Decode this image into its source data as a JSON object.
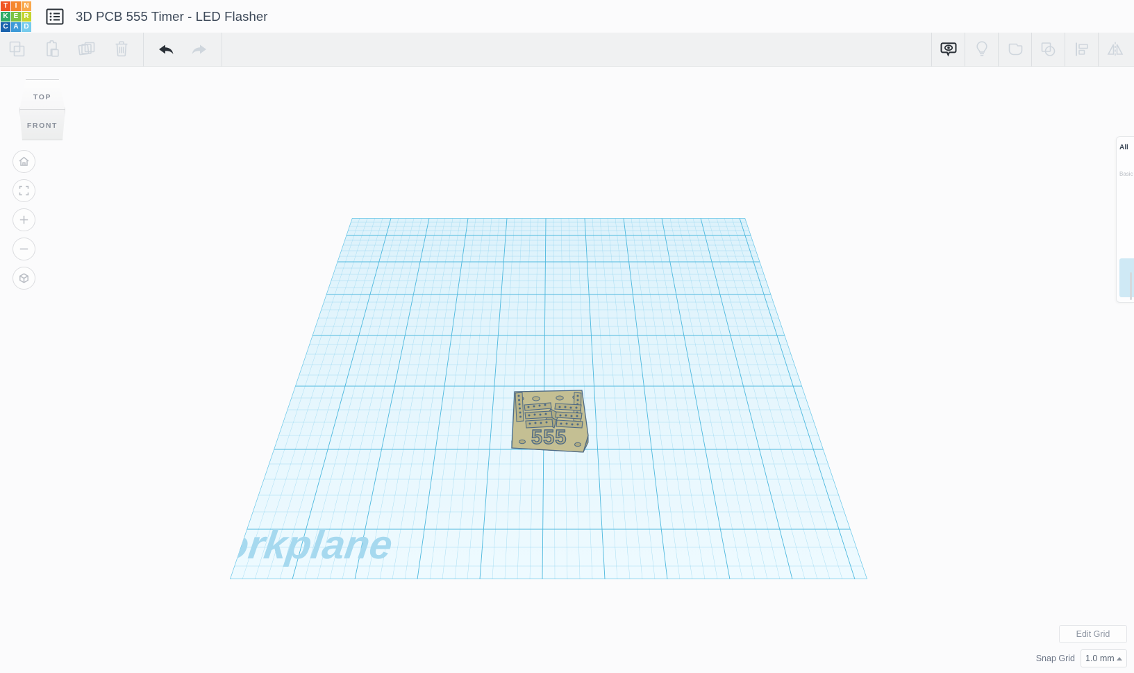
{
  "app": {
    "name": "Tinkercad",
    "logo_letters": [
      {
        "ch": "T",
        "color": "#f05523"
      },
      {
        "ch": "I",
        "color": "#f5872e"
      },
      {
        "ch": "N",
        "color": "#f9a84c"
      },
      {
        "ch": "K",
        "color": "#2fab66"
      },
      {
        "ch": "E",
        "color": "#7cc242"
      },
      {
        "ch": "R",
        "color": "#c3d42e"
      },
      {
        "ch": "C",
        "color": "#1a63ad"
      },
      {
        "ch": "A",
        "color": "#3d9ad8"
      },
      {
        "ch": "D",
        "color": "#76cbec"
      }
    ]
  },
  "header": {
    "document_icon": "list-document-icon",
    "title": "3D PCB 555 Timer - LED Flasher"
  },
  "toolbar": {
    "left_tools": [
      {
        "name": "copy-button",
        "icon": "copy-icon",
        "label": "Copy",
        "enabled": false
      },
      {
        "name": "paste-button",
        "icon": "paste-icon",
        "label": "Paste",
        "enabled": false
      },
      {
        "name": "duplicate-button",
        "icon": "duplicate-icon",
        "label": "Duplicate",
        "enabled": false
      },
      {
        "name": "delete-button",
        "icon": "trash-icon",
        "label": "Delete",
        "enabled": false
      }
    ],
    "history_tools": [
      {
        "name": "undo-button",
        "icon": "undo-arrow-icon",
        "label": "Undo",
        "enabled": true
      },
      {
        "name": "redo-button",
        "icon": "redo-arrow-icon",
        "label": "Redo",
        "enabled": false
      }
    ],
    "right_tools": [
      {
        "name": "show-hide-button",
        "icon": "eye-callout-icon",
        "label": "Show/Hide",
        "enabled": true
      },
      {
        "name": "light-button",
        "icon": "lightbulb-icon",
        "label": "Light",
        "enabled": false
      },
      {
        "name": "group-button",
        "icon": "group-shape-icon",
        "label": "Group",
        "enabled": false
      },
      {
        "name": "ungroup-button",
        "icon": "ungroup-icon",
        "label": "Ungroup",
        "enabled": false
      },
      {
        "name": "align-button",
        "icon": "align-icon",
        "label": "Align",
        "enabled": false
      },
      {
        "name": "mirror-button",
        "icon": "mirror-icon",
        "label": "Mirror",
        "enabled": false
      }
    ]
  },
  "viewcube": {
    "top_face_label": "TOP",
    "front_face_label": "FRONT"
  },
  "nav_controls": [
    {
      "name": "home-view-button",
      "icon": "home-icon",
      "label": "Home view"
    },
    {
      "name": "fit-to-view-button",
      "icon": "fit-brackets-icon",
      "label": "Fit all in view"
    },
    {
      "name": "zoom-in-button",
      "icon": "plus-icon",
      "label": "Zoom in"
    },
    {
      "name": "zoom-out-button",
      "icon": "minus-icon",
      "label": "Zoom out"
    },
    {
      "name": "view-projection-button",
      "icon": "cube-icon",
      "label": "Switch to orthographic/perspective view"
    }
  ],
  "workplane": {
    "label": "Workplane",
    "grid_color": "#5fc4e8",
    "grid_fill": "#e8f7fd",
    "label_color": "#a8d9ee"
  },
  "model": {
    "name": "3D PCB board",
    "silkscreen_text": "555",
    "board_color": "#c4bf93",
    "trace_color": "#5b7a97"
  },
  "right_panel": {
    "title": "All",
    "subtitle": "Basic Shapes",
    "collapsed": true
  },
  "bottom_controls": {
    "edit_grid_label": "Edit Grid",
    "snap_grid_label": "Snap Grid",
    "snap_grid_value": "1.0 mm"
  }
}
